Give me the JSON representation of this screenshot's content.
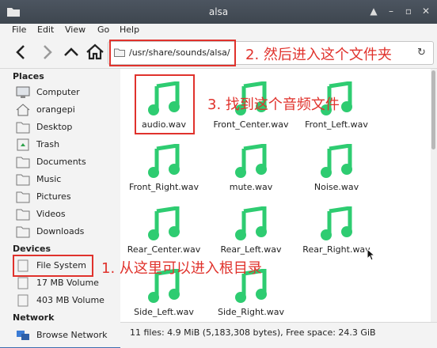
{
  "window": {
    "title": "alsa"
  },
  "menu": [
    "File",
    "Edit",
    "View",
    "Go",
    "Help"
  ],
  "path": "/usr/share/sounds/alsa/",
  "sidebar": {
    "places_header": "Places",
    "places": [
      {
        "label": "Computer",
        "icon": "computer-icon"
      },
      {
        "label": "orangepi",
        "icon": "home-icon"
      },
      {
        "label": "Desktop",
        "icon": "folder-icon"
      },
      {
        "label": "Trash",
        "icon": "trash-icon"
      },
      {
        "label": "Documents",
        "icon": "folder-icon"
      },
      {
        "label": "Music",
        "icon": "folder-icon"
      },
      {
        "label": "Pictures",
        "icon": "folder-icon"
      },
      {
        "label": "Videos",
        "icon": "folder-icon"
      },
      {
        "label": "Downloads",
        "icon": "folder-icon"
      }
    ],
    "devices_header": "Devices",
    "devices": [
      {
        "label": "File System",
        "icon": "drive-icon"
      },
      {
        "label": "17 MB Volume",
        "icon": "drive-icon"
      },
      {
        "label": "403 MB Volume",
        "icon": "drive-icon"
      }
    ],
    "network_header": "Network",
    "network": [
      {
        "label": "Browse Network",
        "icon": "network-icon"
      }
    ]
  },
  "files": [
    "audio.wav",
    "Front_Center.wav",
    "Front_Left.wav",
    "Front_Right.wav",
    "mute.wav",
    "Noise.wav",
    "Rear_Center.wav",
    "Rear_Left.wav",
    "Rear_Right.wav",
    "Side_Left.wav",
    "Side_Right.wav"
  ],
  "status": "11 files: 4.9 MiB (5,183,308 bytes), Free space: 24.3 GiB",
  "annotations": {
    "step1": "1. 从这里可以进入根目录",
    "step2": "2. 然后进入这个文件夹",
    "step3": "3. 找到这个音频文件"
  },
  "colors": {
    "accent_red": "#e0322c",
    "note_green": "#2ecc71"
  }
}
